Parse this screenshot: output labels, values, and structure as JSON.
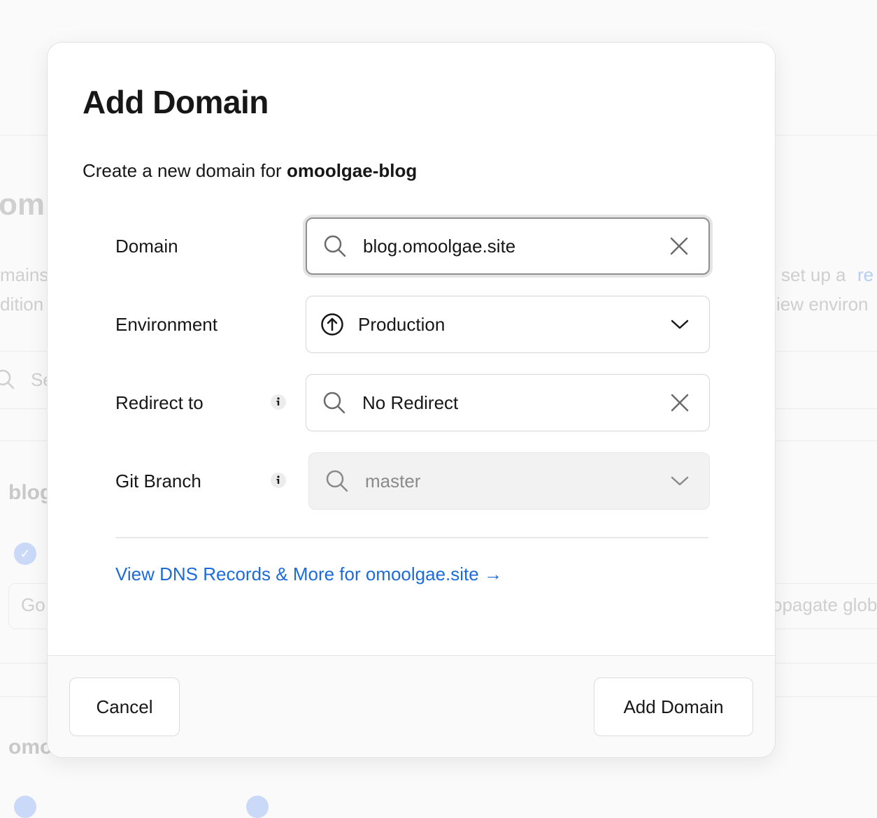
{
  "modal": {
    "title": "Add Domain",
    "subtitle_prefix": "Create a new domain for ",
    "project_name": "omoolgae-blog"
  },
  "fields": {
    "domain": {
      "label": "Domain",
      "value": "blog.omoolgae.site",
      "icon": "search-icon",
      "clear_icon": "close-icon"
    },
    "environment": {
      "label": "Environment",
      "value": "Production",
      "icon": "arrow-up-circle-icon",
      "dropdown_icon": "chevron-down-icon"
    },
    "redirect": {
      "label": "Redirect to",
      "value": "No Redirect",
      "icon": "search-icon",
      "clear_icon": "close-icon",
      "info_icon": "info-icon"
    },
    "git_branch": {
      "label": "Git Branch",
      "value": "master",
      "icon": "search-icon",
      "dropdown_icon": "chevron-down-icon",
      "info_icon": "info-icon",
      "disabled": true
    }
  },
  "dns_link": "View DNS Records & More for omoolgae.site →",
  "footer": {
    "cancel_label": "Cancel",
    "submit_label": "Add Domain"
  },
  "background": {
    "heading_fragment": "om",
    "text_fragments": [
      "mains",
      "dition",
      "set up a",
      "re",
      "iew environ",
      "blog",
      "Go",
      "opagate glob",
      "omo"
    ],
    "search_fragment": "Se"
  },
  "colors": {
    "link": "#1c6bdc",
    "text": "#171717",
    "muted": "#8a8a8a",
    "footer_bg": "#fafafa"
  }
}
